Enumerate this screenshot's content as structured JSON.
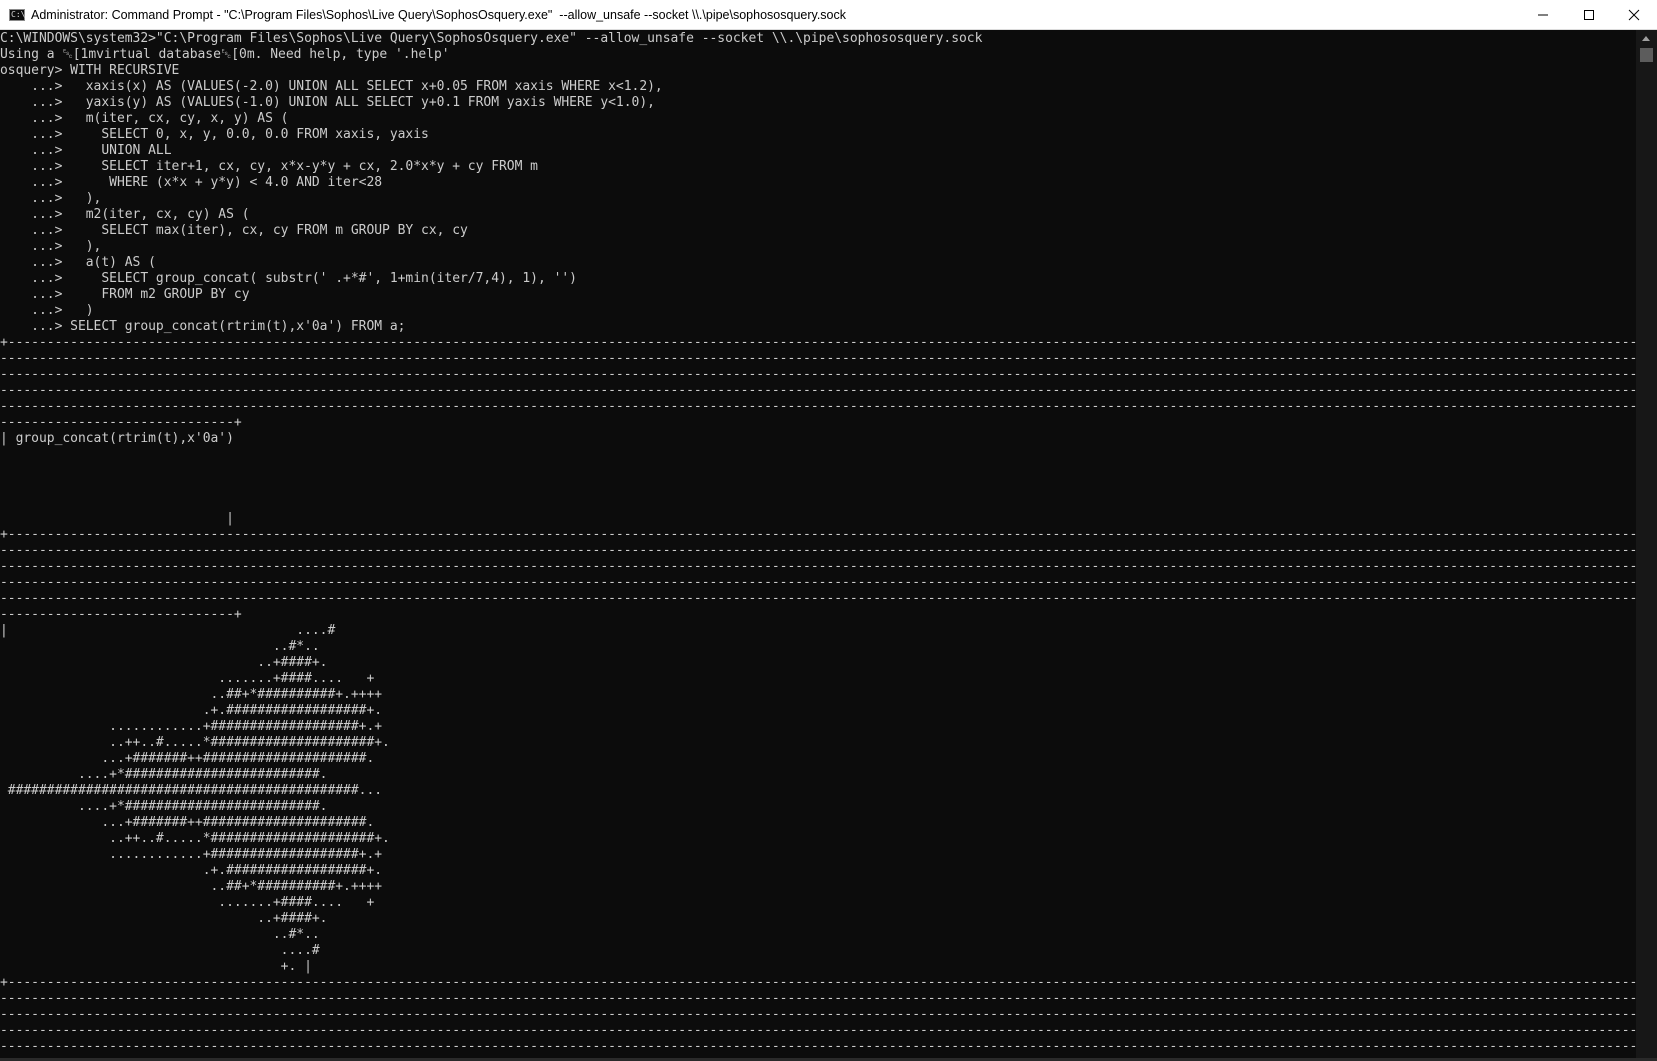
{
  "window": {
    "title": "Administrator: Command Prompt - \"C:\\Program Files\\Sophos\\Live Query\\SophosOsquery.exe\"  --allow_unsafe --socket \\\\.\\pipe\\sophososquery.sock",
    "icon": "cmd-icon",
    "icon_glyph": "C:\\",
    "controls": [
      "minimize-icon",
      "maximize-icon",
      "close-icon"
    ]
  },
  "console": {
    "text": "C:\\WINDOWS\\system32>\"C:\\Program Files\\Sophos\\Live Query\\SophosOsquery.exe\" --allow_unsafe --socket \\\\.\\pipe\\sophososquery.sock\nUsing a ␛[1mvirtual database␛[0m. Need help, type '.help'\nosquery> WITH RECURSIVE\n    ...>   xaxis(x) AS (VALUES(-2.0) UNION ALL SELECT x+0.05 FROM xaxis WHERE x<1.2),\n    ...>   yaxis(y) AS (VALUES(-1.0) UNION ALL SELECT y+0.1 FROM yaxis WHERE y<1.0),\n    ...>   m(iter, cx, cy, x, y) AS (\n    ...>     SELECT 0, x, y, 0.0, 0.0 FROM xaxis, yaxis\n    ...>     UNION ALL\n    ...>     SELECT iter+1, cx, cy, x*x-y*y + cx, 2.0*x*y + cy FROM m\n    ...>      WHERE (x*x + y*y) < 4.0 AND iter<28\n    ...>   ),\n    ...>   m2(iter, cx, cy) AS (\n    ...>     SELECT max(iter), cx, cy FROM m GROUP BY cx, cy\n    ...>   ),\n    ...>   a(t) AS (\n    ...>     SELECT group_concat( substr(' .+*#', 1+min(iter/7,4), 1), '')\n    ...>     FROM m2 GROUP BY cy\n    ...>   )\n    ...> SELECT group_concat(rtrim(t),x'0a') FROM a;\n+-----------------------------------------------------------------------------------------------------------------------------------------------------------------------------------------------------------------------------------------------------------------------\n------------------------------------------------------------------------------------------------------------------------------------------------------------------------------------------------------------------------------------------------------------------------\n------------------------------------------------------------------------------------------------------------------------------------------------------------------------------------------------------------------------------------------------------------------------\n------------------------------------------------------------------------------------------------------------------------------------------------------------------------------------------------------------------------------------------------------------------------\n------------------------------------------------------------------------------------------------------------------------------------------------------------------------------------------------------------------------------------------------------------------------\n------------------------------+\n| group_concat(rtrim(t),x'0a')\n\n\n\n\n                             |\n+-----------------------------------------------------------------------------------------------------------------------------------------------------------------------------------------------------------------------------------------------------------------------\n------------------------------------------------------------------------------------------------------------------------------------------------------------------------------------------------------------------------------------------------------------------------\n------------------------------------------------------------------------------------------------------------------------------------------------------------------------------------------------------------------------------------------------------------------------\n------------------------------------------------------------------------------------------------------------------------------------------------------------------------------------------------------------------------------------------------------------------------\n------------------------------------------------------------------------------------------------------------------------------------------------------------------------------------------------------------------------------------------------------------------------\n------------------------------+\n|                                     ....#\n                                   ..#*..\n                                 ..+####+.\n                            .......+####....   +\n                           ..##+*##########+.++++\n                          .+.##################+.\n              ............+###################+.+\n              ..++..#.....*#####################+.\n             ...+#######++#####################.\n          ....+*#########################.\n #############################################...\n          ....+*#########################.\n             ...+#######++#####################.\n              ..++..#.....*#####################+.\n              ............+###################+.+\n                          .+.##################+.\n                           ..##+*##########+.++++\n                            .......+####....   +\n                                 ..+####+.\n                                   ..#*..\n                                    ....#\n                                    +. |\n+-----------------------------------------------------------------------------------------------------------------------------------------------------------------------------------------------------------------------------------------------------------------------\n------------------------------------------------------------------------------------------------------------------------------------------------------------------------------------------------------------------------------------------------------------------------\n------------------------------------------------------------------------------------------------------------------------------------------------------------------------------------------------------------------------------------------------------------------------\n------------------------------------------------------------------------------------------------------------------------------------------------------------------------------------------------------------------------------------------------------------------------\n------------------------------------------------------------------------------------------------------------------------------------------------------------------------------------------------------------------------------------------------------------------------\n------------------------------+"
  },
  "colors": {
    "console_background": "#0c0c0c",
    "console_foreground": "#cccccc",
    "titlebar_background": "#ffffff",
    "title_text": "#000000",
    "scrollbar_thumb": "#5c5c5c"
  },
  "scrollbar": {
    "icon": "scroll-up-arrow-icon"
  }
}
